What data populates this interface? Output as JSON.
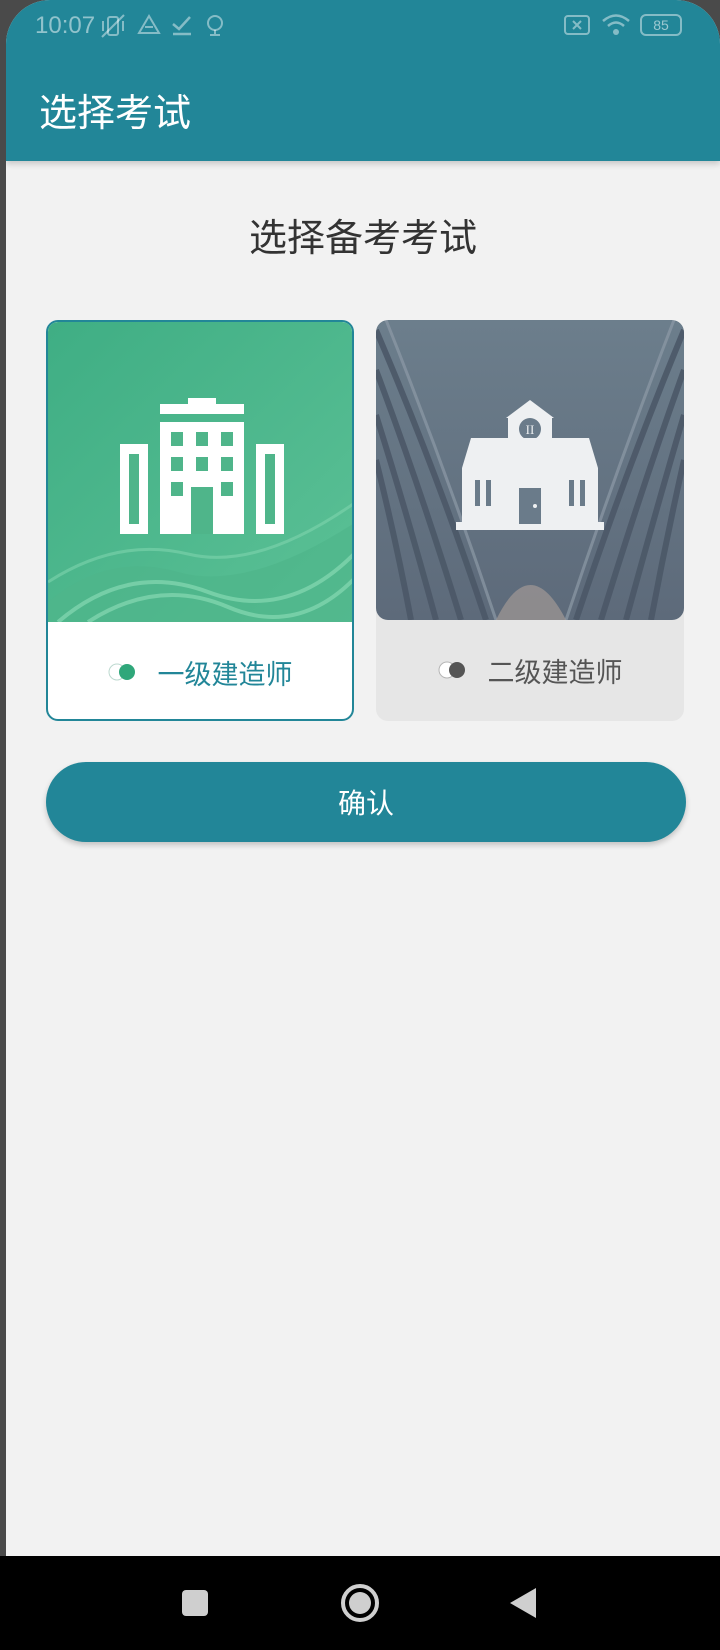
{
  "status_bar": {
    "time": "10:07",
    "battery": "85",
    "icons": [
      "vibrate-off-icon",
      "drive-icon",
      "check-icon",
      "location-icon",
      "sim-off-icon",
      "wifi-icon",
      "battery-icon"
    ]
  },
  "app_bar": {
    "title": "选择考试"
  },
  "main": {
    "heading": "选择备考考试",
    "options": [
      {
        "label": "一级建造师",
        "selected": true,
        "icon": "office-building-icon"
      },
      {
        "label": "二级建造师",
        "selected": false,
        "icon": "institution-building-icon"
      }
    ],
    "confirm_label": "确认"
  },
  "colors": {
    "primary": "#228698",
    "card1_accent": "#4fb58a",
    "card2_accent": "#6a7b8a",
    "background": "#f2f2f2"
  },
  "nav_bar": {
    "icons": [
      "recent-apps-icon",
      "home-icon",
      "back-icon"
    ]
  }
}
